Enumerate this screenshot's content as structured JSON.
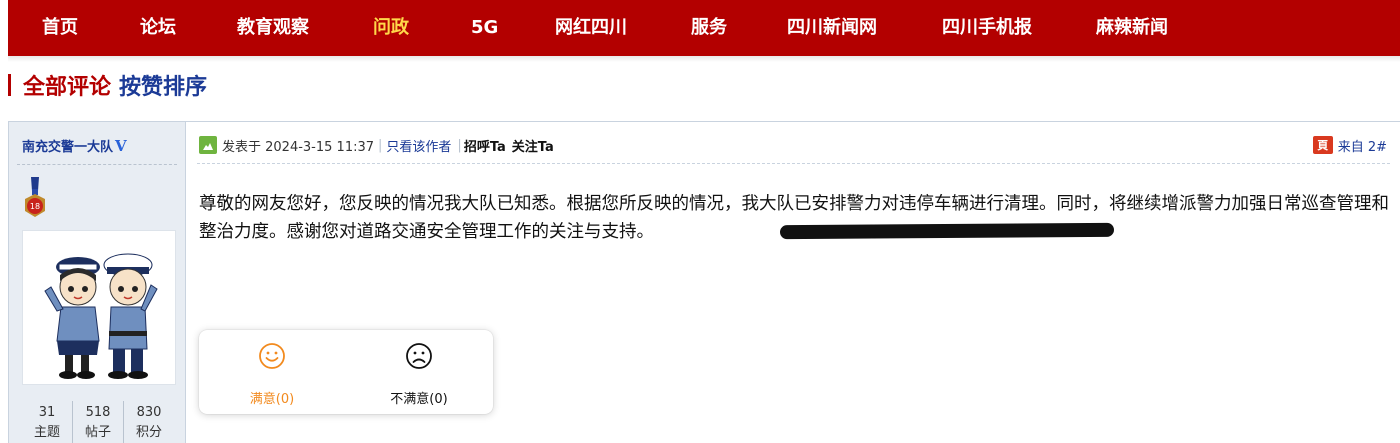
{
  "nav": {
    "items": [
      {
        "label": "首页"
      },
      {
        "label": "论坛"
      },
      {
        "label": "教育观察"
      },
      {
        "label": "问政"
      },
      {
        "label": "5G"
      },
      {
        "label": "网红四川"
      },
      {
        "label": "服务"
      },
      {
        "label": "四川新闻网"
      },
      {
        "label": "四川手机报"
      },
      {
        "label": "麻辣新闻"
      }
    ],
    "active_item": "问政",
    "active_color": "#ffd84a",
    "bar_color": "#b30000"
  },
  "section": {
    "all_comments": "全部评论",
    "sort_by_likes": "按赞排序"
  },
  "author": {
    "name": "南充交警一大队",
    "verified_mark": "V",
    "medal_level": "18",
    "stats": [
      {
        "value": "31",
        "label": "主题"
      },
      {
        "value": "518",
        "label": "帖子"
      },
      {
        "value": "830",
        "label": "积分"
      }
    ]
  },
  "post": {
    "posted_label": "发表于 2024-3-15 11:37",
    "only_author_link": "只看该作者",
    "greet_link": "招呼Ta",
    "follow_link": "关注Ta",
    "source_icon_text": "頁",
    "source_text": "来自 2#",
    "body": "尊敬的网友您好，您反映的情况我大队已知悉。根据您所反映的情况，我大队已安排警力对违停车辆进行清理。同时，将继续增派警力加强日常巡查管理和整治力度。感谢您对道路交通安全管理工作的关注与支持。"
  },
  "reactions": {
    "satisfied": "满意(0)",
    "unsatisfied": "不满意(0)",
    "satisfied_color": "#f28a1e"
  }
}
